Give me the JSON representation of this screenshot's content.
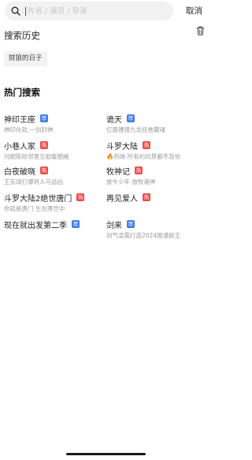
{
  "search": {
    "placeholder": "片名 / 演员 / 导演"
  },
  "cancel_label": "取消",
  "history": {
    "title": "搜索历史",
    "items": [
      "财狼的日子"
    ]
  },
  "hot": {
    "title": "热门搜索",
    "items": [
      {
        "name": "神印王座",
        "badge": "荐",
        "badge_type": "rec",
        "desc": "神印化软,一剑封神"
      },
      {
        "name": "诡天",
        "badge": "荐",
        "badge_type": "rec",
        "desc": "亿面镖镜九龙挂卷藏魂"
      },
      {
        "name": "小巷人家",
        "badge": "热",
        "badge_type": "hot",
        "desc": "闫妮陈欣邻里互助暖憩融"
      },
      {
        "name": "斗罗大陆",
        "badge": "热",
        "badge_type": "hot",
        "desc": "🔥热映 所有的风景都不及你"
      },
      {
        "name": "白夜破晓",
        "badge": "热",
        "badge_type": "hot",
        "desc": "王东阔打爆坍人马追凶"
      },
      {
        "name": "牧神记",
        "badge": "热",
        "badge_type": "hot",
        "desc": "放牛少年 放牧诸神"
      },
      {
        "name": "斗罗大陆2绝世唐门",
        "badge": "热",
        "badge_type": "hot",
        "desc": "你就是唐门 生在唐世中"
      },
      {
        "name": "再见爱人",
        "badge": "热",
        "badge_type": "hot",
        "desc": ""
      },
      {
        "name": "现在就出发第二季",
        "badge": "荐",
        "badge_type": "rec",
        "desc": ""
      },
      {
        "name": "剑来",
        "badge": "荐",
        "badge_type": "rec",
        "desc": "剑气凌霜打造2024国漫剧王"
      }
    ]
  },
  "colors": {
    "hot_badge": "#f04a4a",
    "rec_badge": "#3f7cf0"
  }
}
